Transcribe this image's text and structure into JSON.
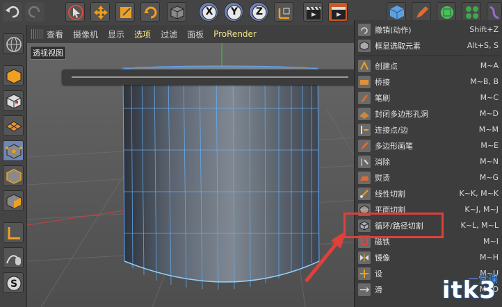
{
  "toolbar": {
    "axis_labels": [
      "X",
      "Y",
      "Z"
    ]
  },
  "viewport": {
    "menu": [
      "查看",
      "摄像机",
      "显示",
      "选项",
      "过滤",
      "面板",
      "ProRender"
    ],
    "active_menu": "选项",
    "label": "透视视图"
  },
  "context_menu": {
    "items": [
      {
        "label": "撤销(动作)",
        "shortcut": "Shift+Z"
      },
      {
        "label": "框显选取元素",
        "shortcut": "Alt+S, S"
      },
      {
        "label": "创建点",
        "shortcut": "M~A"
      },
      {
        "label": "桥接",
        "shortcut": "M~B, B"
      },
      {
        "label": "笔刷",
        "shortcut": "M~C"
      },
      {
        "label": "封闭多边形孔洞",
        "shortcut": "M~D"
      },
      {
        "label": "连接点/边",
        "shortcut": "M~M"
      },
      {
        "label": "多边形画笔",
        "shortcut": "M~E"
      },
      {
        "label": "消除",
        "shortcut": "M~N"
      },
      {
        "label": "熨烫",
        "shortcut": "M~G"
      },
      {
        "label": "线性切割",
        "shortcut": "K~K, M~K"
      },
      {
        "label": "平面切割",
        "shortcut": "K~J, M~J"
      },
      {
        "label": "循环/路径切割",
        "shortcut": "K~L, M~L"
      },
      {
        "label": "磁铁",
        "shortcut": "M~I"
      },
      {
        "label": "镜像",
        "shortcut": "M~H"
      },
      {
        "label": "设",
        "shortcut": "M~U"
      },
      {
        "label": "滑",
        "shortcut": "M~O"
      }
    ]
  },
  "watermark": {
    "text": "itk3",
    "sub": "一堂课"
  },
  "colors": {
    "highlight": "#e0403a",
    "accent": "#6f86b5"
  }
}
